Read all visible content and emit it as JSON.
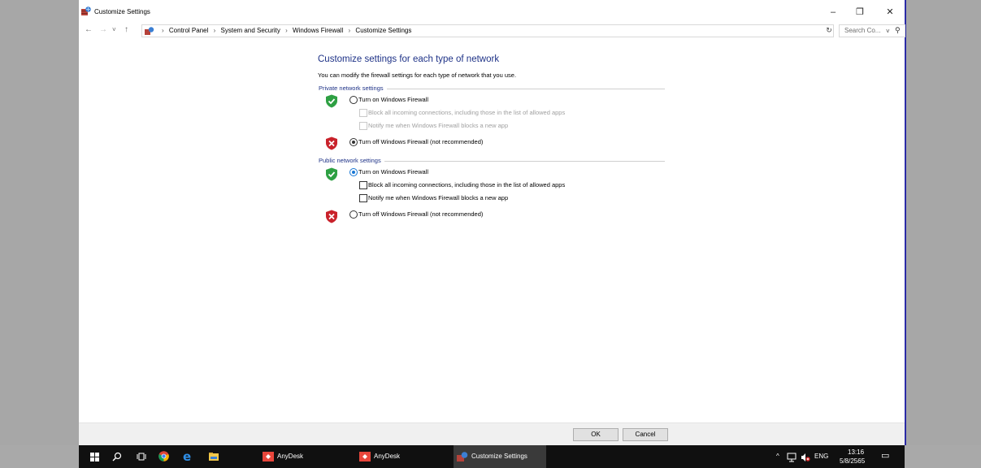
{
  "window": {
    "title": "Customize Settings",
    "minimize_glyph": "–",
    "restore_glyph": "❐",
    "close_glyph": "✕"
  },
  "address": {
    "back_glyph": "←",
    "forward_glyph": "→",
    "recent_glyph": "˅",
    "up_glyph": "↑",
    "crumbs": [
      "Control Panel",
      "System and Security",
      "Windows Firewall",
      "Customize Settings"
    ],
    "crumb_separator": "›",
    "dropdown_glyph": "˅",
    "refresh_glyph": "↻",
    "search_placeholder": "Search Co...",
    "search_glyph": "⚲"
  },
  "page": {
    "title": "Customize settings for each type of network",
    "description": "You can modify the firewall settings for each type of network that you use."
  },
  "private": {
    "header": "Private network settings",
    "turn_on": {
      "label": "Turn on Windows Firewall",
      "selected": false
    },
    "block_all": {
      "label": "Block all incoming connections, including those in the list of allowed apps",
      "checked": false,
      "enabled": false
    },
    "notify": {
      "label": "Notify me when Windows Firewall blocks a new app",
      "checked": false,
      "enabled": false
    },
    "turn_off": {
      "label": "Turn off Windows Firewall (not recommended)",
      "selected": true
    }
  },
  "public": {
    "header": "Public network settings",
    "turn_on": {
      "label": "Turn on Windows Firewall",
      "selected": true
    },
    "block_all": {
      "label": "Block all incoming connections, including those in the list of allowed apps",
      "checked": false,
      "enabled": true
    },
    "notify": {
      "label": "Notify me when Windows Firewall blocks a new app",
      "checked": false,
      "enabled": true
    },
    "turn_off": {
      "label": "Turn off Windows Firewall (not recommended)",
      "selected": false
    }
  },
  "footer": {
    "ok_label": "OK",
    "cancel_label": "Cancel"
  },
  "taskbar": {
    "apps": [
      {
        "label": "AnyDesk",
        "icon": "anydesk-icon"
      },
      {
        "label": "AnyDesk",
        "icon": "anydesk-icon"
      },
      {
        "label": "Customize Settings",
        "icon": "firewall-icon"
      }
    ],
    "tray_chevron": "^",
    "language": "ENG",
    "time": "13:16",
    "date": "5/8/2565",
    "notification_glyph": "▭"
  },
  "colors": {
    "link_blue": "#1e3287",
    "shield_green": "#2ea043",
    "shield_red": "#c9222b",
    "anydesk_red": "#e8463b",
    "taskbar": "#101010"
  }
}
